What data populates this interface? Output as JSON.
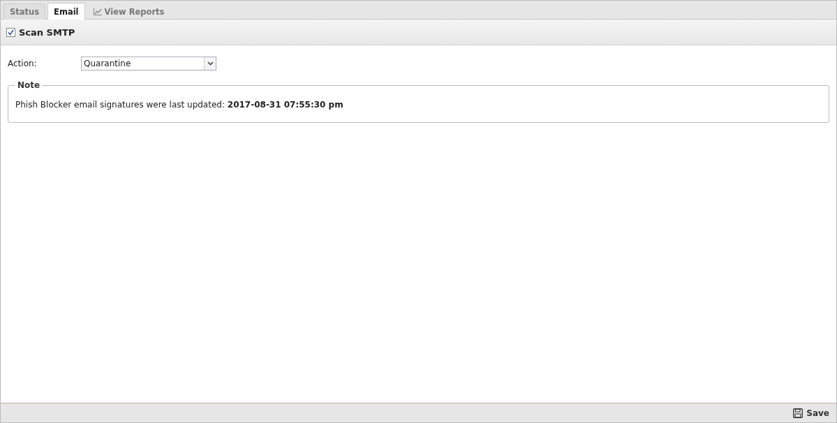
{
  "tabs": [
    {
      "label": "Status",
      "selected": false,
      "kind": "plain"
    },
    {
      "label": "Email",
      "selected": true,
      "kind": "plain"
    },
    {
      "label": "View Reports",
      "selected": false,
      "kind": "report"
    }
  ],
  "scan": {
    "label": "Scan SMTP",
    "checked": true
  },
  "action": {
    "label": "Action:",
    "value": "Quarantine"
  },
  "note": {
    "title": "Note",
    "text": "Phish Blocker email signatures were last updated: **2017-08-31 07:55:30 pm**"
  },
  "footer": {
    "save": "Save"
  }
}
